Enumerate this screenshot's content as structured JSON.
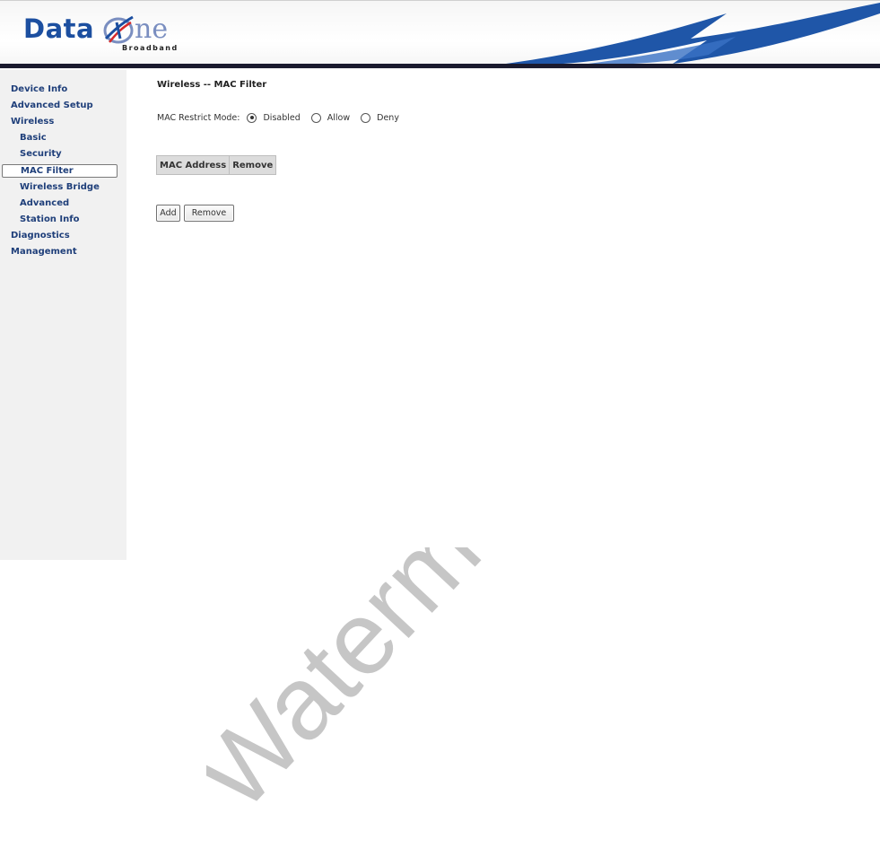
{
  "header": {
    "logo_text_data": "Data",
    "logo_text_ne": "ne",
    "logo_subtext": "Broadband",
    "accent_color": "#1c4fa0",
    "swoosh_color": "#1f56a8"
  },
  "sidebar": {
    "items": [
      {
        "label": "Device Info",
        "level": 0,
        "active": false
      },
      {
        "label": "Advanced Setup",
        "level": 0,
        "active": false
      },
      {
        "label": "Wireless",
        "level": 0,
        "active": false
      },
      {
        "label": "Basic",
        "level": 1,
        "active": false
      },
      {
        "label": "Security",
        "level": 1,
        "active": false
      },
      {
        "label": "MAC Filter",
        "level": 1,
        "active": true
      },
      {
        "label": "Wireless Bridge",
        "level": 1,
        "active": false
      },
      {
        "label": "Advanced",
        "level": 1,
        "active": false
      },
      {
        "label": "Station Info",
        "level": 1,
        "active": false
      },
      {
        "label": "Diagnostics",
        "level": 0,
        "active": false
      },
      {
        "label": "Management",
        "level": 0,
        "active": false
      }
    ]
  },
  "main": {
    "title": "Wireless -- MAC Filter",
    "restrict_mode": {
      "label": "MAC Restrict Mode:",
      "options": [
        {
          "label": "Disabled",
          "checked": true
        },
        {
          "label": "Allow",
          "checked": false
        },
        {
          "label": "Deny",
          "checked": false
        }
      ]
    },
    "table": {
      "headers": [
        "MAC Address",
        "Remove"
      ]
    },
    "buttons": {
      "add_label": "Add",
      "remove_label": "Remove"
    }
  },
  "watermark": {
    "text": "Waterm",
    "color": "#c8c8c8"
  }
}
